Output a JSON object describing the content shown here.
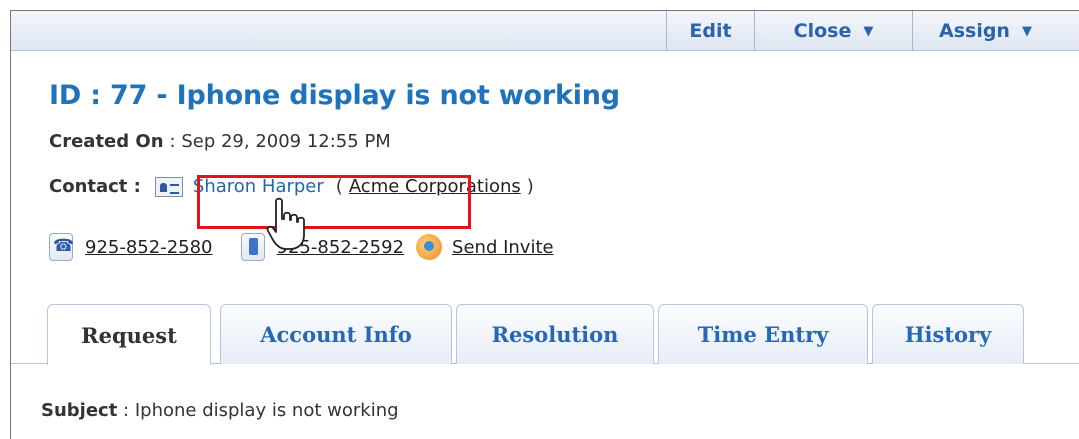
{
  "toolbar": {
    "edit_label": "Edit",
    "close_label": "Close",
    "assign_label": "Assign"
  },
  "request": {
    "title": "ID : 77 - Iphone display is not working",
    "created_label": "Created On",
    "created_value": ": Sep 29, 2009 12:55 PM",
    "contact_label": "Contact :",
    "contact_name": "Sharon Harper",
    "paren_open": "(",
    "company": "Acme Corporations",
    "paren_close": ")",
    "phone_1": "925-852-2580",
    "phone_2": "925-852-2592",
    "send_invite": "Send Invite"
  },
  "tabs": [
    {
      "label": "Request",
      "active": true
    },
    {
      "label": "Account Info"
    },
    {
      "label": "Resolution"
    },
    {
      "label": "Time Entry"
    },
    {
      "label": "History"
    }
  ],
  "content": {
    "subject_label": "Subject",
    "subject_value": " : Iphone display is not working"
  },
  "icons": {
    "contact_card": "vcard-icon",
    "phone": "phone-icon",
    "mobile": "mobile-icon",
    "invite": "invite-icon",
    "cursor": "hand-cursor-icon"
  },
  "colors": {
    "title_blue": "#1f73bb",
    "link_blue": "#2467b0",
    "highlight_red": "#e1141c"
  }
}
